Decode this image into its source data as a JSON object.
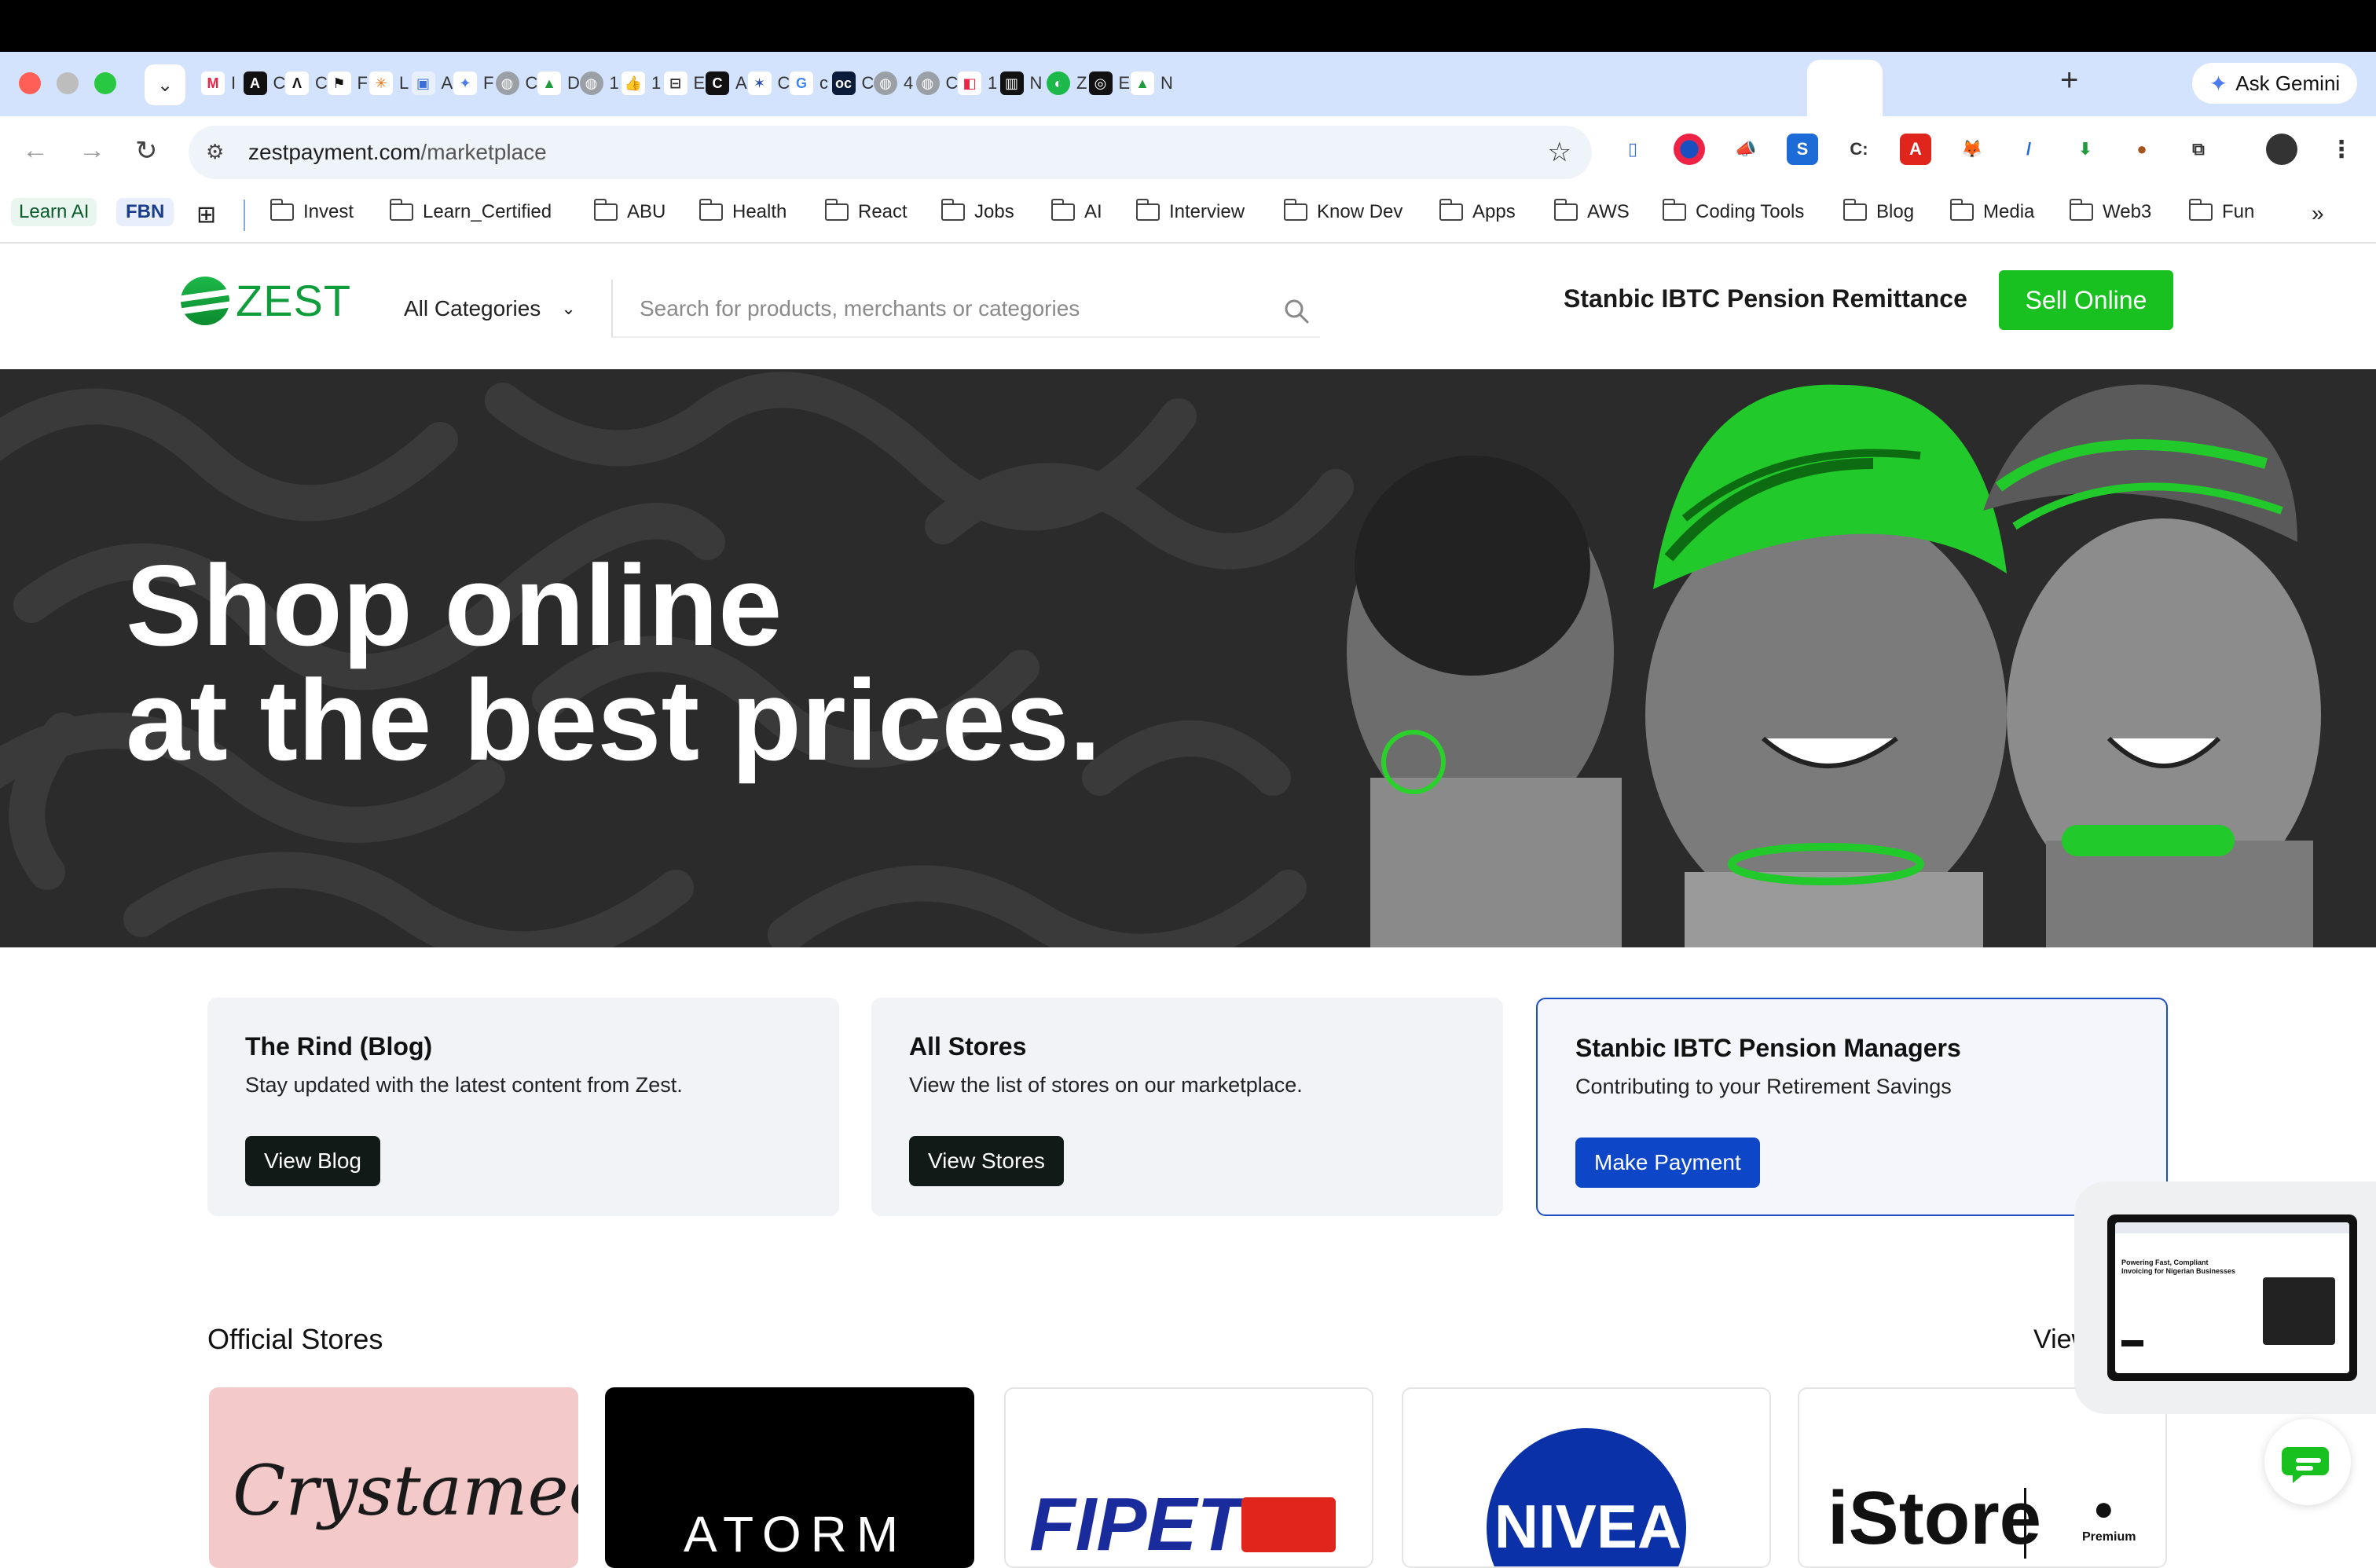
{
  "browser": {
    "ask_gemini": "Ask Gemini",
    "url_host": "zestpayment.com",
    "url_path": "/marketplace",
    "tabs": [
      {
        "icon": "gmail-icon",
        "label": "I"
      },
      {
        "icon": "a-icon",
        "label": "C"
      },
      {
        "icon": "anthropic-icon",
        "label": "C"
      },
      {
        "icon": "framer-icon",
        "label": "F"
      },
      {
        "icon": "claude-icon",
        "label": "L"
      },
      {
        "icon": "app-icon",
        "label": "A"
      },
      {
        "icon": "gemini-icon",
        "label": "F"
      },
      {
        "icon": "globe-icon",
        "label": "C"
      },
      {
        "icon": "drive-icon",
        "label": "D"
      },
      {
        "icon": "globe-icon",
        "label": "1"
      },
      {
        "icon": "thumb-icon",
        "label": "1"
      },
      {
        "icon": "doc-icon",
        "label": "E"
      },
      {
        "icon": "c-icon",
        "label": "A"
      },
      {
        "icon": "star-icon",
        "label": "C"
      },
      {
        "icon": "google-icon",
        "label": "c"
      },
      {
        "icon": "oc-icon",
        "label": "C"
      },
      {
        "icon": "globe-icon",
        "label": "4"
      },
      {
        "icon": "globe-icon",
        "label": "C"
      },
      {
        "icon": "figma-icon",
        "label": "1"
      },
      {
        "icon": "notion-icon",
        "label": "N"
      },
      {
        "icon": "zest-icon",
        "label": "Z"
      },
      {
        "icon": "e-icon",
        "label": "E"
      },
      {
        "icon": "drive-icon",
        "label": "N"
      }
    ],
    "bookmarks_pinned": [
      "Learn AI",
      "FBN"
    ],
    "bookmarks": [
      "Invest",
      "Learn_Certified",
      "ABU",
      "Health",
      "React",
      "Jobs",
      "AI",
      "Interview",
      "Know Dev",
      "Apps",
      "AWS",
      "Coding Tools",
      "Blog",
      "Media",
      "Web3",
      "Fun"
    ]
  },
  "site": {
    "logo_text": "ZEST",
    "category_select": "All Categories",
    "search_placeholder": "Search for products, merchants or categories",
    "pension_link": "Stanbic IBTC Pension Remittance",
    "sell_button": "Sell Online",
    "hero_line1": "Shop online",
    "hero_line2": "at the best prices.",
    "cards": [
      {
        "title": "The Rind (Blog)",
        "subtitle": "Stay updated with the latest content from Zest.",
        "button": "View Blog"
      },
      {
        "title": "All Stores",
        "subtitle": "View the list of stores on our marketplace.",
        "button": "View Stores"
      },
      {
        "title": "Stanbic IBTC Pension Managers",
        "subtitle": "Contributing to your Retirement Savings",
        "button": "Make Payment"
      }
    ],
    "stores_title": "Official Stores",
    "view_all": "View A",
    "stores": [
      "Crystamec",
      "ATORM",
      "FIPET",
      "NIVEA",
      "iStore"
    ],
    "istore_badge": "Premium",
    "pip": {
      "heading": "Powering Fast, Compliant Invoicing for Nigerian Businesses"
    }
  },
  "colors": {
    "brand_green": "#18c11f",
    "dark_button": "#121a17",
    "blue_button": "#0d47c7",
    "hero_bg": "#2b2b2b"
  }
}
